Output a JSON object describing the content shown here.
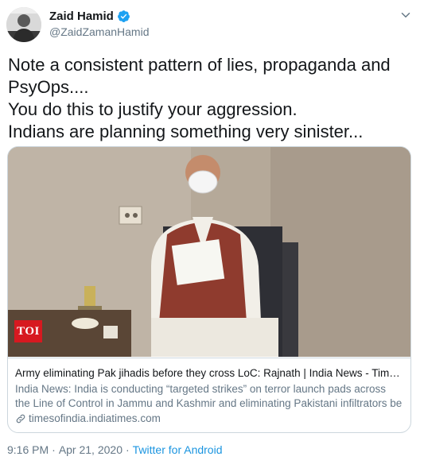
{
  "author": {
    "display_name": "Zaid Hamid",
    "handle": "@ZaidZamanHamid",
    "verified": true,
    "avatar_icon": "profile-photo"
  },
  "tweet": {
    "text": "Note a consistent pattern of lies, propaganda and PsyOps....\nYou do this to justify your aggression.\nIndians are planning something very sinister..."
  },
  "card": {
    "image_badge": "TOI",
    "title": "Army eliminating Pak jihadis before they cross LoC: Rajnath | India News - Times o...",
    "description": "India News: India is conducting “targeted strikes” on terror launch pads across the Line of Control in Jammu and Kashmir and eliminating Pakistani infiltrators be",
    "domain": "timesofindia.indiatimes.com",
    "link_icon": "link-icon"
  },
  "meta": {
    "time": "9:16 PM",
    "separator": "·",
    "date": "Apr 21, 2020",
    "source": "Twitter for Android"
  },
  "colors": {
    "verified_blue": "#1da1f2",
    "link_blue": "#1b95e0",
    "muted_gray": "#657786",
    "toi_red": "#d71920"
  }
}
